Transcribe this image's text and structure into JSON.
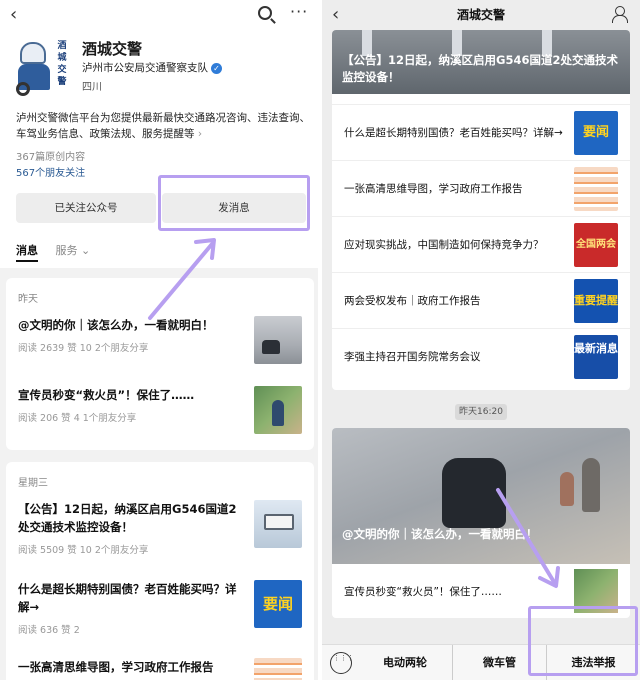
{
  "left": {
    "account": {
      "name": "酒城交警",
      "subtitle": "泸州市公安局交通警察支队",
      "location": "四川",
      "avatar_text": "酒城交警",
      "intro": "泸州交警微信平台为您提供最新最快交通路况咨询、违法查询、车驾业务信息、政策法规、服务提醒等",
      "posts_count": "367篇原创内容",
      "friends_following": "567个朋友关注"
    },
    "buttons": {
      "followed": "已关注公众号",
      "send_message": "发消息"
    },
    "tabs": [
      "消息",
      "服务"
    ],
    "groups": [
      {
        "date": "昨天",
        "items": [
          {
            "title": "@文明的你｜该怎么办，一看就明白！",
            "meta": "阅读 2639  赞 10  2个朋友分享"
          },
          {
            "title": "宣传员秒变“救火员”！保住了……",
            "meta": "阅读 206  赞 4  1个朋友分享"
          }
        ]
      },
      {
        "date": "星期三",
        "items": [
          {
            "title": "【公告】12日起，纳溪区启用G546国道2处交通技术监控设备！",
            "meta": "阅读 5509  赞 10  2个朋友分享"
          },
          {
            "title": "什么是超长期特别国债？老百姓能买吗？详解→",
            "meta": "阅读 636  赞 2",
            "thumb_text": "要闻"
          },
          {
            "title": "一张高清思维导图，学习政府工作报告",
            "meta": ""
          }
        ]
      }
    ]
  },
  "right": {
    "header_title": "酒城交警",
    "banner_title": "【公告】12日起，纳溪区启用G546国道2处交通技术监控设备！",
    "rows": [
      {
        "title": "什么是超长期特别国债？老百姓能买吗？详解→",
        "thumb_text": "要闻"
      },
      {
        "title": "一张高清思维导图，学习政府工作报告",
        "thumb_text": ""
      },
      {
        "title": "应对现实挑战，中国制造如何保持竞争力？",
        "thumb_text": "全国两会"
      },
      {
        "title": "两会受权发布｜政府工作报告",
        "thumb_text": "重要提醒"
      },
      {
        "title": "李强主持召开国务院常务会议",
        "thumb_text": "最新消息"
      }
    ],
    "timestamp": "昨天16:20",
    "photo_caption": "@文明的你｜该怎么办，一看就明白！",
    "second_row_title": "宣传员秒变“救火员”！保住了……",
    "menu": [
      "电动两轮",
      "微车管",
      "违法举报"
    ]
  },
  "colors": {
    "highlight": "#b79ff0",
    "link_blue": "#2b5b94",
    "verified_blue": "#2f7cd8"
  }
}
